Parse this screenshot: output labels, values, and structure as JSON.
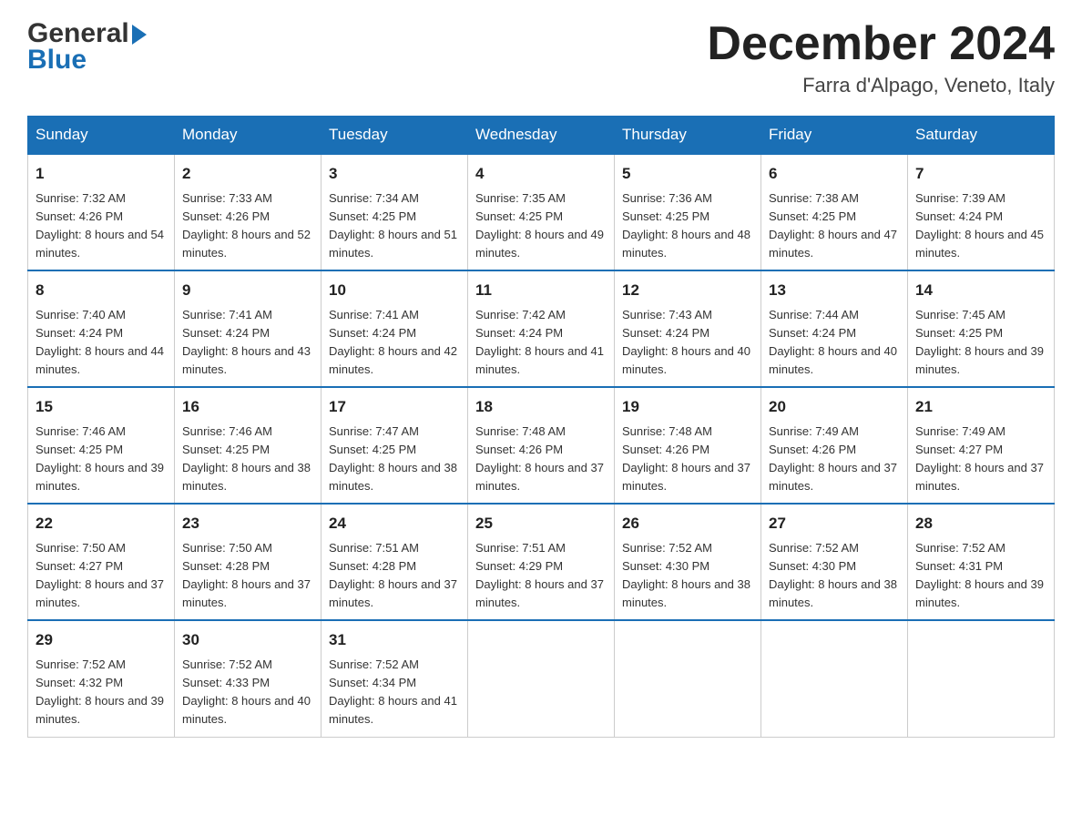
{
  "header": {
    "logo_main": "General",
    "logo_accent": "Blue",
    "month_title": "December 2024",
    "subtitle": "Farra d'Alpago, Veneto, Italy"
  },
  "days_of_week": [
    "Sunday",
    "Monday",
    "Tuesday",
    "Wednesday",
    "Thursday",
    "Friday",
    "Saturday"
  ],
  "weeks": [
    [
      {
        "day": "1",
        "sunrise": "7:32 AM",
        "sunset": "4:26 PM",
        "daylight": "8 hours and 54 minutes."
      },
      {
        "day": "2",
        "sunrise": "7:33 AM",
        "sunset": "4:26 PM",
        "daylight": "8 hours and 52 minutes."
      },
      {
        "day": "3",
        "sunrise": "7:34 AM",
        "sunset": "4:25 PM",
        "daylight": "8 hours and 51 minutes."
      },
      {
        "day": "4",
        "sunrise": "7:35 AM",
        "sunset": "4:25 PM",
        "daylight": "8 hours and 49 minutes."
      },
      {
        "day": "5",
        "sunrise": "7:36 AM",
        "sunset": "4:25 PM",
        "daylight": "8 hours and 48 minutes."
      },
      {
        "day": "6",
        "sunrise": "7:38 AM",
        "sunset": "4:25 PM",
        "daylight": "8 hours and 47 minutes."
      },
      {
        "day": "7",
        "sunrise": "7:39 AM",
        "sunset": "4:24 PM",
        "daylight": "8 hours and 45 minutes."
      }
    ],
    [
      {
        "day": "8",
        "sunrise": "7:40 AM",
        "sunset": "4:24 PM",
        "daylight": "8 hours and 44 minutes."
      },
      {
        "day": "9",
        "sunrise": "7:41 AM",
        "sunset": "4:24 PM",
        "daylight": "8 hours and 43 minutes."
      },
      {
        "day": "10",
        "sunrise": "7:41 AM",
        "sunset": "4:24 PM",
        "daylight": "8 hours and 42 minutes."
      },
      {
        "day": "11",
        "sunrise": "7:42 AM",
        "sunset": "4:24 PM",
        "daylight": "8 hours and 41 minutes."
      },
      {
        "day": "12",
        "sunrise": "7:43 AM",
        "sunset": "4:24 PM",
        "daylight": "8 hours and 40 minutes."
      },
      {
        "day": "13",
        "sunrise": "7:44 AM",
        "sunset": "4:24 PM",
        "daylight": "8 hours and 40 minutes."
      },
      {
        "day": "14",
        "sunrise": "7:45 AM",
        "sunset": "4:25 PM",
        "daylight": "8 hours and 39 minutes."
      }
    ],
    [
      {
        "day": "15",
        "sunrise": "7:46 AM",
        "sunset": "4:25 PM",
        "daylight": "8 hours and 39 minutes."
      },
      {
        "day": "16",
        "sunrise": "7:46 AM",
        "sunset": "4:25 PM",
        "daylight": "8 hours and 38 minutes."
      },
      {
        "day": "17",
        "sunrise": "7:47 AM",
        "sunset": "4:25 PM",
        "daylight": "8 hours and 38 minutes."
      },
      {
        "day": "18",
        "sunrise": "7:48 AM",
        "sunset": "4:26 PM",
        "daylight": "8 hours and 37 minutes."
      },
      {
        "day": "19",
        "sunrise": "7:48 AM",
        "sunset": "4:26 PM",
        "daylight": "8 hours and 37 minutes."
      },
      {
        "day": "20",
        "sunrise": "7:49 AM",
        "sunset": "4:26 PM",
        "daylight": "8 hours and 37 minutes."
      },
      {
        "day": "21",
        "sunrise": "7:49 AM",
        "sunset": "4:27 PM",
        "daylight": "8 hours and 37 minutes."
      }
    ],
    [
      {
        "day": "22",
        "sunrise": "7:50 AM",
        "sunset": "4:27 PM",
        "daylight": "8 hours and 37 minutes."
      },
      {
        "day": "23",
        "sunrise": "7:50 AM",
        "sunset": "4:28 PM",
        "daylight": "8 hours and 37 minutes."
      },
      {
        "day": "24",
        "sunrise": "7:51 AM",
        "sunset": "4:28 PM",
        "daylight": "8 hours and 37 minutes."
      },
      {
        "day": "25",
        "sunrise": "7:51 AM",
        "sunset": "4:29 PM",
        "daylight": "8 hours and 37 minutes."
      },
      {
        "day": "26",
        "sunrise": "7:52 AM",
        "sunset": "4:30 PM",
        "daylight": "8 hours and 38 minutes."
      },
      {
        "day": "27",
        "sunrise": "7:52 AM",
        "sunset": "4:30 PM",
        "daylight": "8 hours and 38 minutes."
      },
      {
        "day": "28",
        "sunrise": "7:52 AM",
        "sunset": "4:31 PM",
        "daylight": "8 hours and 39 minutes."
      }
    ],
    [
      {
        "day": "29",
        "sunrise": "7:52 AM",
        "sunset": "4:32 PM",
        "daylight": "8 hours and 39 minutes."
      },
      {
        "day": "30",
        "sunrise": "7:52 AM",
        "sunset": "4:33 PM",
        "daylight": "8 hours and 40 minutes."
      },
      {
        "day": "31",
        "sunrise": "7:52 AM",
        "sunset": "4:34 PM",
        "daylight": "8 hours and 41 minutes."
      },
      null,
      null,
      null,
      null
    ]
  ]
}
